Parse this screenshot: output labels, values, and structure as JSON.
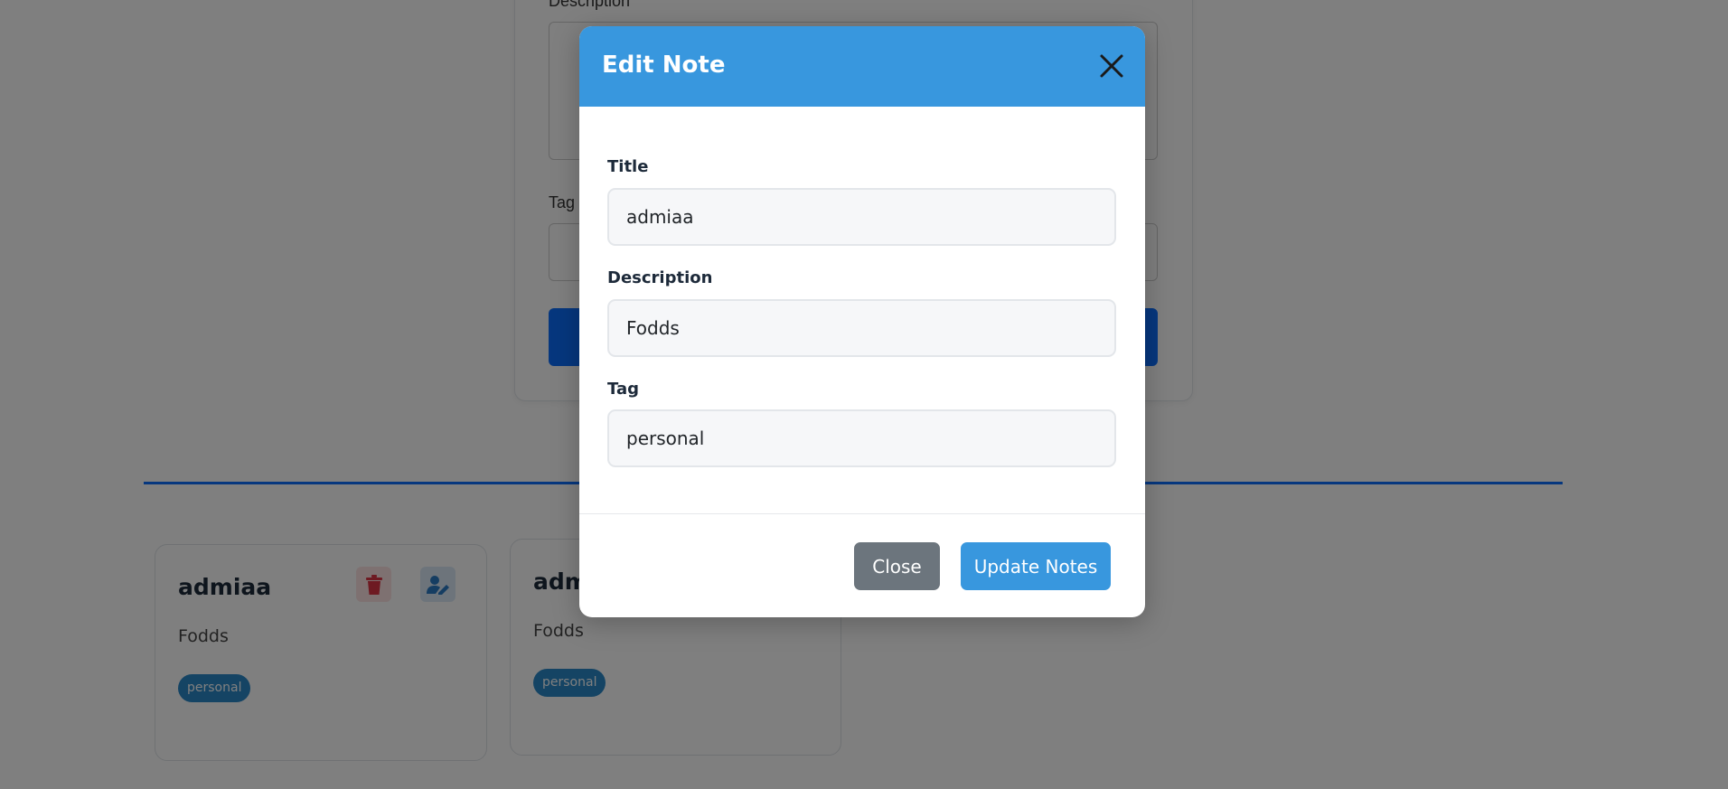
{
  "form": {
    "description_label": "Description",
    "tag_label": "Tag"
  },
  "notes": [
    {
      "title": "admiaa",
      "description": "Fodds",
      "tag": "personal"
    },
    {
      "title": "admi",
      "description": "Fodds",
      "tag": "personal"
    }
  ],
  "modal": {
    "title": "Edit Note",
    "fields": {
      "title": {
        "label": "Title",
        "value": "admiaa"
      },
      "description": {
        "label": "Description",
        "value": "Fodds"
      },
      "tag": {
        "label": "Tag",
        "value": "personal"
      }
    },
    "close_label": "Close",
    "update_label": "Update Notes"
  },
  "colors": {
    "primary": "#0d6efd",
    "modal_header": "#3897de",
    "tag_badge": "#2a89c9",
    "close_button": "#6c757d",
    "delete_icon": "#dc3545"
  },
  "icons": {
    "delete": "trash-icon",
    "edit": "user-edit-icon",
    "close": "close-icon"
  }
}
